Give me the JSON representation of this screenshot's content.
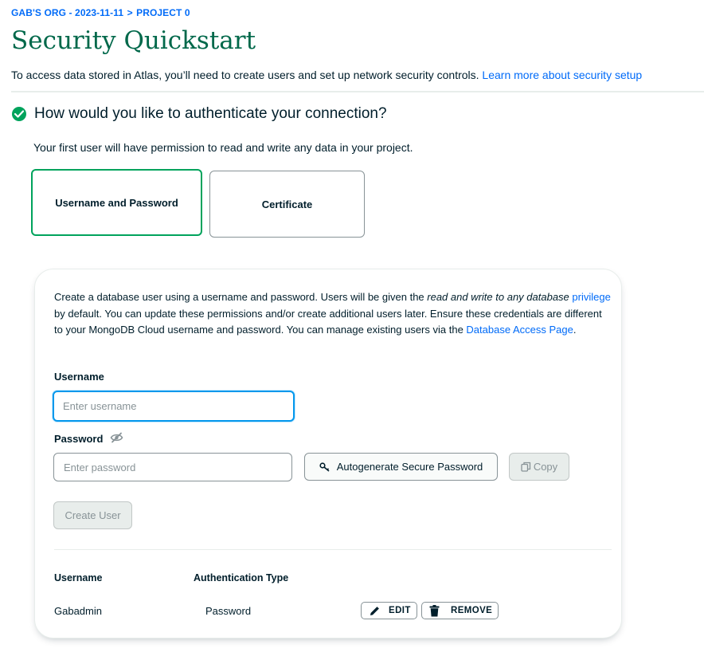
{
  "breadcrumb": {
    "org_label": "GAB'S ORG - 2023-11-11",
    "separator": ">",
    "project_label": "PROJECT 0"
  },
  "page": {
    "title": "Security Quickstart",
    "intro_text": "To access data stored in Atlas, you’ll need to create users and set up network security controls.",
    "intro_link": "Learn more about security setup"
  },
  "auth_section": {
    "title": "How would you like to authenticate your connection?",
    "subtitle": "Your first user will have permission to read and write any data in your project.",
    "options": [
      {
        "label": "Username and Password",
        "selected": true
      },
      {
        "label": "Certificate",
        "selected": false
      }
    ]
  },
  "panel": {
    "desc_part1": "Create a database user using a username and password. Users will be given the ",
    "desc_em": "read and write to any database",
    "desc_link1": "privilege",
    "desc_part2": " by default. You can update these permissions and/or create additional users later. Ensure these credentials are different to your MongoDB Cloud username and password. You can manage existing users via the ",
    "desc_link2": "Database Access Page",
    "desc_end": ".",
    "username_label": "Username",
    "username_placeholder": "Enter username",
    "username_value": "",
    "password_label": "Password",
    "password_placeholder": "Enter password",
    "password_value": "",
    "autogenerate_label": "Autogenerate Secure Password",
    "copy_label": "Copy",
    "create_user_label": "Create User"
  },
  "users_table": {
    "columns": [
      "Username",
      "Authentication Type"
    ],
    "rows": [
      {
        "username": "Gabadmin",
        "auth_type": "Password"
      }
    ],
    "edit_label": "EDIT",
    "remove_label": "REMOVE"
  },
  "colors": {
    "brand_green": "#00684a",
    "check_green": "#00a35c",
    "link_blue": "#016bf8",
    "focus_blue": "#0498ec"
  },
  "icons": [
    "check-circle-icon",
    "eye-slash-icon",
    "key-icon",
    "copy-icon",
    "pencil-icon",
    "trash-icon"
  ]
}
